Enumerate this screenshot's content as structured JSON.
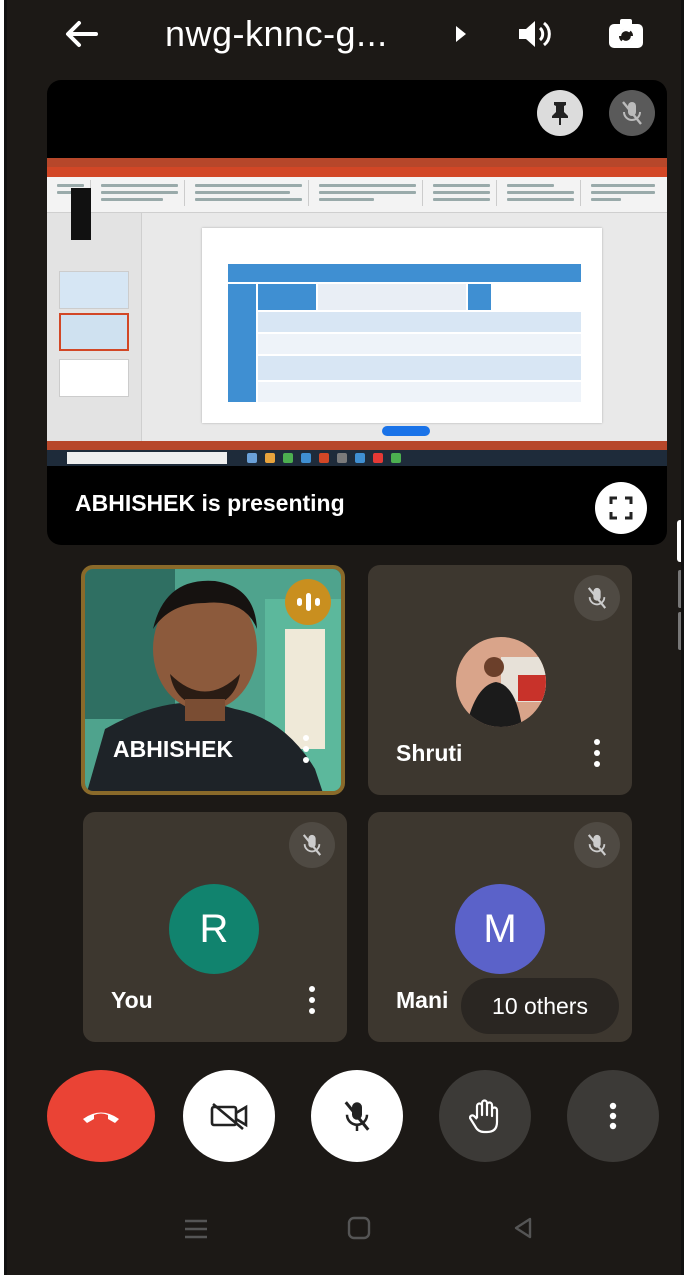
{
  "topbar": {
    "meeting_code": "nwg-knnc-g...",
    "back_icon": "arrow-left-icon",
    "more_icon": "caret-right-icon",
    "audio_icon": "speaker-icon",
    "switch_camera_icon": "camera-switch-icon"
  },
  "presentation": {
    "label": "ABHISHEK is presenting",
    "pin_icon": "pin-icon",
    "mute_icon": "mic-off-icon",
    "fullscreen_icon": "fullscreen-icon"
  },
  "participants": [
    {
      "name": "ABHISHEK",
      "state": "speaking",
      "has_video": true
    },
    {
      "name": "Shruti",
      "state": "muted",
      "has_photo": true
    },
    {
      "name": "You",
      "initial": "R",
      "state": "muted",
      "avatar_color": "#11836e"
    },
    {
      "name": "Mani",
      "initial": "M",
      "state": "muted",
      "avatar_color": "#5b62c9"
    }
  ],
  "others_badge": "10 others",
  "controls": {
    "end_call": {
      "icon": "phone-hangup-icon",
      "color": "#ea4335"
    },
    "camera": {
      "icon": "video-off-icon",
      "color": "#ffffff"
    },
    "mic": {
      "icon": "mic-off-icon",
      "color": "#ffffff"
    },
    "raise_hand": {
      "icon": "hand-icon",
      "color": "#3c3a37"
    },
    "more": {
      "icon": "more-vertical-icon",
      "color": "#3c3a37"
    }
  },
  "nav": {
    "recent": "recents-icon",
    "home": "home-icon",
    "back": "back-triangle-icon"
  },
  "colors": {
    "background": "#1c1916",
    "tile": "#3d372f",
    "speaking": "#c98f1f"
  }
}
